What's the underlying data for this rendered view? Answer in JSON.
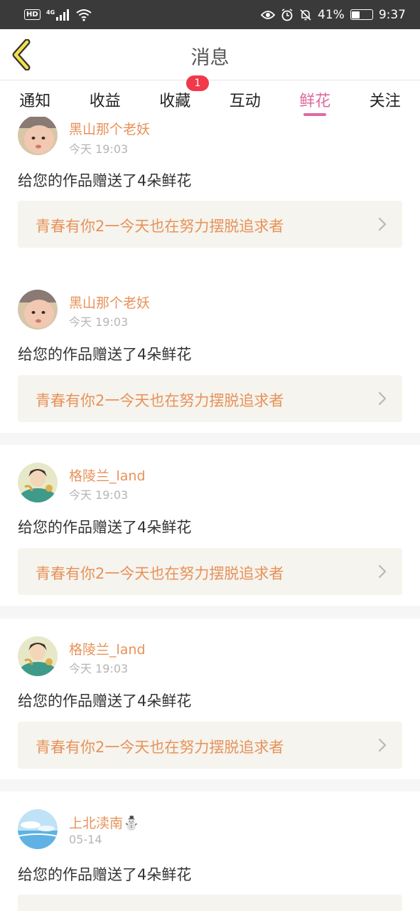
{
  "status_bar": {
    "hd_badge": "HD",
    "network": "4G",
    "battery_percent": "41%",
    "battery_level": 0.41,
    "time": "9:37"
  },
  "header": {
    "title": "消息",
    "back_icon": "back-chevron-icon"
  },
  "tabs": [
    {
      "label": "通知"
    },
    {
      "label": "收益"
    },
    {
      "label": "收藏",
      "badge": "1"
    },
    {
      "label": "互动"
    },
    {
      "label": "鲜花",
      "active": true
    },
    {
      "label": "关注"
    }
  ],
  "feed": [
    {
      "user": "黑山那个老妖",
      "time": "今天 19:03",
      "message": "给您的作品赠送了4朵鲜花",
      "work": "青春有你2一今天也在努力摆脱追求者",
      "avatar": "baby-photo-avatar"
    },
    {
      "user": "黑山那个老妖",
      "time": "今天 19:03",
      "message": "给您的作品赠送了4朵鲜花",
      "work": "青春有你2一今天也在努力摆脱追求者",
      "avatar": "baby-photo-avatar"
    },
    {
      "user": "格陵兰_land",
      "time": "今天 19:03",
      "message": "给您的作品赠送了4朵鲜花",
      "work": "青春有你2一今天也在努力摆脱追求者",
      "avatar": "anime-character-avatar"
    },
    {
      "user": "格陵兰_land",
      "time": "今天 19:03",
      "message": "给您的作品赠送了4朵鲜花",
      "work": "青春有你2一今天也在努力摆脱追求者",
      "avatar": "anime-character-avatar"
    },
    {
      "user": "上北渎南⛄",
      "time": "05-14",
      "message": "给您的作品赠送了4朵鲜花",
      "work": "",
      "avatar": "sky-photo-avatar"
    }
  ],
  "colors": {
    "accent_pink": "#e06aa0",
    "username_orange": "#e8925a",
    "badge_red": "#f0394b",
    "link_bg": "#f5f4ee"
  }
}
